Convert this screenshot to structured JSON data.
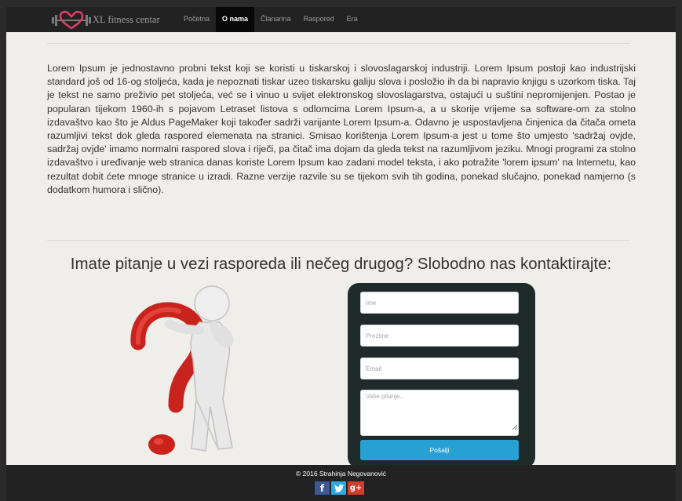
{
  "brand": {
    "name": "XL fitness centar",
    "logo": "heart-barbell-icon"
  },
  "nav": {
    "items": [
      {
        "label": "Početna",
        "active": false
      },
      {
        "label": "O nama",
        "active": true
      },
      {
        "label": "Članarina",
        "active": false
      },
      {
        "label": "Raspored",
        "active": false
      },
      {
        "label": "Era",
        "active": false
      }
    ]
  },
  "content": {
    "paragraph": "Lorem Ipsum je jednostavno probni tekst koji se koristi u tiskarskoj i slovoslagarskoj industriji. Lorem Ipsum postoji kao industrijski standard još od 16-og stoljeća, kada je nepoznati tiskar uzeo tiskarsku galiju slova i posložio ih da bi napravio knjigu s uzorkom tiska. Taj je tekst ne samo preživio pet stoljeća, već se i vinuo u svijet elektronskog slovoslagarstva, ostajući u suštini nepromijenjen. Postao je popularan tijekom 1960-ih s pojavom Letraset listova s odlomcima Lorem Ipsum-a, a u skorije vrijeme sa software-om za stolno izdavaštvo kao što je Aldus PageMaker koji također sadrži varijante Lorem Ipsum-a. Odavno je uspostavljena činjenica da čitača ometa razumljivi tekst dok gleda raspored elemenata na stranici. Smisao korištenja Lorem Ipsum-a jest u tome što umjesto 'sadržaj ovjde, sadržaj ovjde' imamo normalni raspored slova i riječi, pa čitač ima dojam da gleda tekst na razumljivom jeziku. Mnogi programi za stolno izdavaštvo i uređivanje web stranica danas koriste Lorem Ipsum kao zadani model teksta, i ako potražite 'lorem ipsum' na Internetu, kao rezultat dobit ćete mnoge stranice u izradi. Razne verzije razvile su se tijekom svih tih godina, ponekad slučajno, ponekad namjerno (s dodatkom humora i slično)."
  },
  "contact": {
    "heading": "Imate pitanje u vezi rasporeda ili nečeg drugog? Slobodno nas kontaktirajte:",
    "illustration": "question-mark-figure-icon",
    "fields": {
      "first_name": {
        "placeholder": "Ime",
        "value": ""
      },
      "last_name": {
        "placeholder": "Prezime",
        "value": ""
      },
      "email": {
        "placeholder": "Email",
        "value": ""
      },
      "question": {
        "placeholder": "Vaše pitanje...",
        "value": ""
      }
    },
    "submit_label": "Pošalji"
  },
  "footer": {
    "copyright": "© 2016 Strahinja Negovanović",
    "social": [
      {
        "icon": "facebook-icon",
        "glyph": "f",
        "color": "#3b5998"
      },
      {
        "icon": "twitter-icon",
        "glyph": "t",
        "color": "#2ba9e1"
      },
      {
        "icon": "google-plus-icon",
        "glyph": "g+",
        "color": "#d13e2b"
      }
    ]
  },
  "colors": {
    "navbar": "#222222",
    "page": "#efeeea",
    "form_panel": "#1f2b2b",
    "submit": "#27a0d2",
    "logo_heart": "#d6406a"
  }
}
